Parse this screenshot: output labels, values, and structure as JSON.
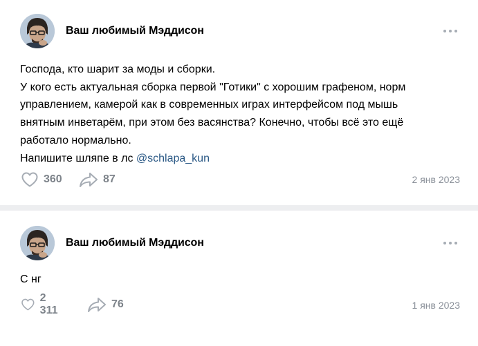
{
  "posts": [
    {
      "author": "Ваш любимый Мэддисон",
      "text_lines": [
        "Господа, кто шарит за моды и сборки.",
        "У кого есть актуальная сборка первой \"Готики\" с хорошим графеном, норм",
        "управлением, камерой как в современных играх интерфейсом под мышь",
        "внятным инветарём, при этом без васянства? Конечно, чтобы всё это ещё",
        "работало нормально."
      ],
      "last_line_prefix": "Напишите шляпе в лс ",
      "mention": "@schlapa_kun",
      "likes": "360",
      "shares": "87",
      "date": "2 янв 2023"
    },
    {
      "author": "Ваш любимый Мэддисон",
      "text_lines": [
        "С нг"
      ],
      "likes": "2 311",
      "shares": "76",
      "date": "1 янв 2023"
    }
  ],
  "icons": {
    "like": "heart-icon",
    "share": "share-arrow-icon",
    "more": "more-dots-icon"
  },
  "colors": {
    "background": "#edeef0",
    "card": "#ffffff",
    "link": "#2a5885",
    "muted": "#7d838a",
    "icon": "#a6acb4"
  }
}
